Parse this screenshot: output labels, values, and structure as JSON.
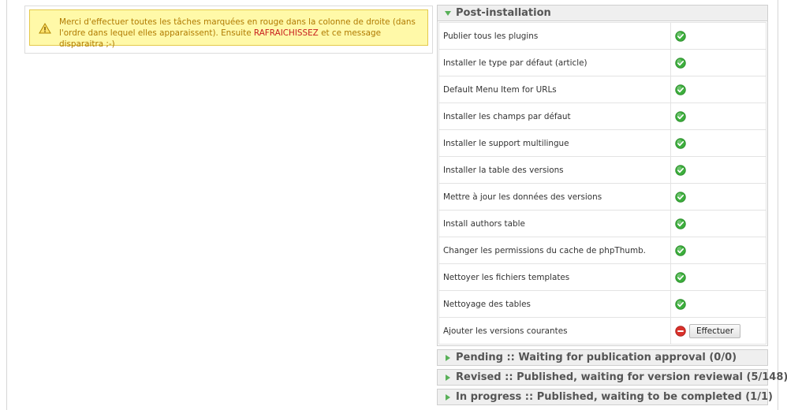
{
  "notice": {
    "text_before": "Merci d'effectuer toutes les tâches marquées en rouge dans la colonne de droite (dans l'ordre dans lequel elles apparaissent). Ensuite ",
    "highlight": "RAFRAICHISSEZ",
    "text_after": " et ce message disparaitra ;-)",
    "icon": "warning-icon"
  },
  "post_installation": {
    "title": "Post-installation",
    "expanded": true,
    "tasks": [
      {
        "label": "Publier tous les plugins",
        "status": "done"
      },
      {
        "label": "Installer le type par défaut (article)",
        "status": "done"
      },
      {
        "label": "Default Menu Item for URLs",
        "status": "done"
      },
      {
        "label": "Installer les champs par défaut",
        "status": "done"
      },
      {
        "label": "Installer le support multilingue",
        "status": "done"
      },
      {
        "label": "Installer la table des versions",
        "status": "done"
      },
      {
        "label": "Mettre à jour les données des versions",
        "status": "done"
      },
      {
        "label": "Install authors table",
        "status": "done"
      },
      {
        "label": "Changer les permissions du cache de phpThumb.",
        "status": "done"
      },
      {
        "label": "Nettoyer les fichiers templates",
        "status": "done"
      },
      {
        "label": "Nettoyage des tables",
        "status": "done"
      },
      {
        "label": "Ajouter les versions courantes",
        "status": "todo",
        "action_label": "Effectuer"
      }
    ]
  },
  "sections": [
    {
      "title": "Pending :: Waiting for publication approval (0/0)"
    },
    {
      "title": "Revised :: Published, waiting for version reviewal (5/148)"
    },
    {
      "title": "In progress :: Published, waiting to be completed (1/1)"
    }
  ],
  "colors": {
    "done": "#3cae3c",
    "todo": "#d9312b",
    "arrow": "#58b058",
    "notice_bg": "#fff9a8",
    "notice_text": "#b07a00",
    "highlight": "#c81d1d"
  }
}
